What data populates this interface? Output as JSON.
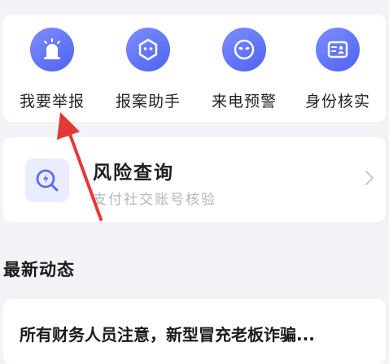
{
  "quick_actions": [
    {
      "label": "我要举报",
      "icon": "alarm-siren-icon"
    },
    {
      "label": "报案助手",
      "icon": "robot-helper-icon"
    },
    {
      "label": "来电预警",
      "icon": "mask-warning-icon"
    },
    {
      "label": "身份核实",
      "icon": "id-card-icon"
    }
  ],
  "risk": {
    "title": "风险查询",
    "subtitle": "支付社交账号核验",
    "icon": "search-lightning-icon"
  },
  "news": {
    "section_title": "最新动态",
    "items": [
      {
        "title": "所有财务人员注意，新型冒充老板诈骗..."
      }
    ]
  },
  "colors": {
    "accent": "#5b6cf6",
    "annotation_arrow": "#e53935",
    "background": "#f2f3f7"
  }
}
